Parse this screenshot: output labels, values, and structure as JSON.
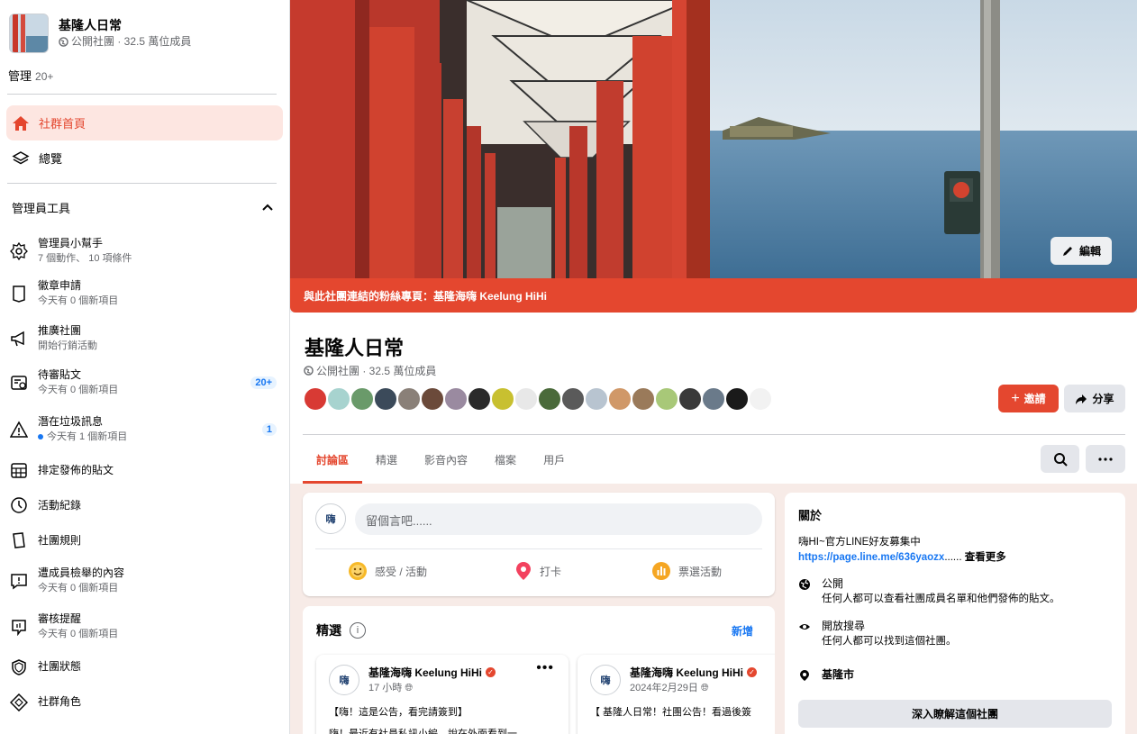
{
  "sidebar": {
    "group_name": "基隆人日常",
    "group_meta": "公開社團 · 32.5 萬位成員",
    "manage_label": "管理",
    "manage_count": "20+",
    "nav_home": "社群首頁",
    "nav_overview": "總覽",
    "admin_tools_label": "管理員工具",
    "tools": [
      {
        "title": "管理員小幫手",
        "sub": "7 個動作、 10 項條件",
        "icon": "assistant-icon"
      },
      {
        "title": "徽章申請",
        "sub": "今天有 0 個新項目",
        "icon": "badge-icon"
      },
      {
        "title": "推廣社團",
        "sub": "開始行銷活動",
        "icon": "megaphone-icon"
      },
      {
        "title": "待審貼文",
        "sub": "今天有 0 個新項目",
        "badge": "20+",
        "icon": "pending-posts-icon"
      },
      {
        "title": "潛在垃圾訊息",
        "sub": "今天有 1 個新項目",
        "badge": "1",
        "icon": "warning-icon"
      },
      {
        "title": "排定發佈的貼文",
        "icon": "calendar-icon"
      },
      {
        "title": "活動紀錄",
        "icon": "clock-icon"
      },
      {
        "title": "社團規則",
        "icon": "rules-icon"
      },
      {
        "title": "遭成員檢舉的內容",
        "sub": "今天有 0 個新項目",
        "icon": "report-icon"
      },
      {
        "title": "審核提醒",
        "sub": "今天有 0 個新項目",
        "icon": "alert-icon"
      },
      {
        "title": "社團狀態",
        "icon": "shield-icon"
      },
      {
        "title": "社群角色",
        "icon": "roles-icon"
      }
    ]
  },
  "cover": {
    "edit_label": "編輯",
    "banner_text": "與此社團連結的粉絲專頁：基隆海嗨 Keelung HiHi"
  },
  "header": {
    "title": "基隆人日常",
    "meta": "公開社團 · 32.5 萬位成員",
    "invite_label": "邀請",
    "share_label": "分享",
    "avatar_colors": [
      "#d83a34",
      "#a7d3cf",
      "#6a9a6a",
      "#3b4a5a",
      "#8a8078",
      "#6b4a3a",
      "#9a8aa0",
      "#2a2a2a",
      "#c8c030",
      "#e8e8e8",
      "#4a6a3a",
      "#5a5a5a",
      "#b8c4d0",
      "#d09868",
      "#9a7a5a",
      "#a8c878",
      "#3a3a3a",
      "#6a7a8a",
      "#1a1a1a",
      "#f2f2f2"
    ],
    "tabs": [
      "討論區",
      "精選",
      "影音內容",
      "檔案",
      "用戶"
    ]
  },
  "composer": {
    "avatar_text": "嗨",
    "placeholder": "留個言吧......",
    "actions": [
      "感受 / 活動",
      "打卡",
      "票選活動"
    ]
  },
  "featured": {
    "title": "精選",
    "add_label": "新增",
    "posts": [
      {
        "author": "基隆海嗨 Keelung HiHi",
        "time": "17 小時",
        "line1": "【嗨！這是公告，看完請簽到】",
        "line2": "嗨！最近有社員私訊小編，說在外面看到一"
      },
      {
        "author": "基隆海嗨 Keelung HiHi",
        "time": "2024年2月29日",
        "line1": "【 基隆人日常！社團公告！看過後簽",
        "line2": ""
      }
    ]
  },
  "about": {
    "title": "關於",
    "desc_line1": "嗨HI~官方LINE好友募集中",
    "link": "https://page.line.me/636yaozx",
    "ellipsis": "......",
    "see_more": "查看更多",
    "public_title": "公開",
    "public_desc": "任何人都可以查看社團成員名單和他們發佈的貼文。",
    "visible_title": "開放搜尋",
    "visible_desc": "任何人都可以找到這個社團。",
    "location": "基隆市",
    "learn_more": "深入瞭解這個社團"
  }
}
